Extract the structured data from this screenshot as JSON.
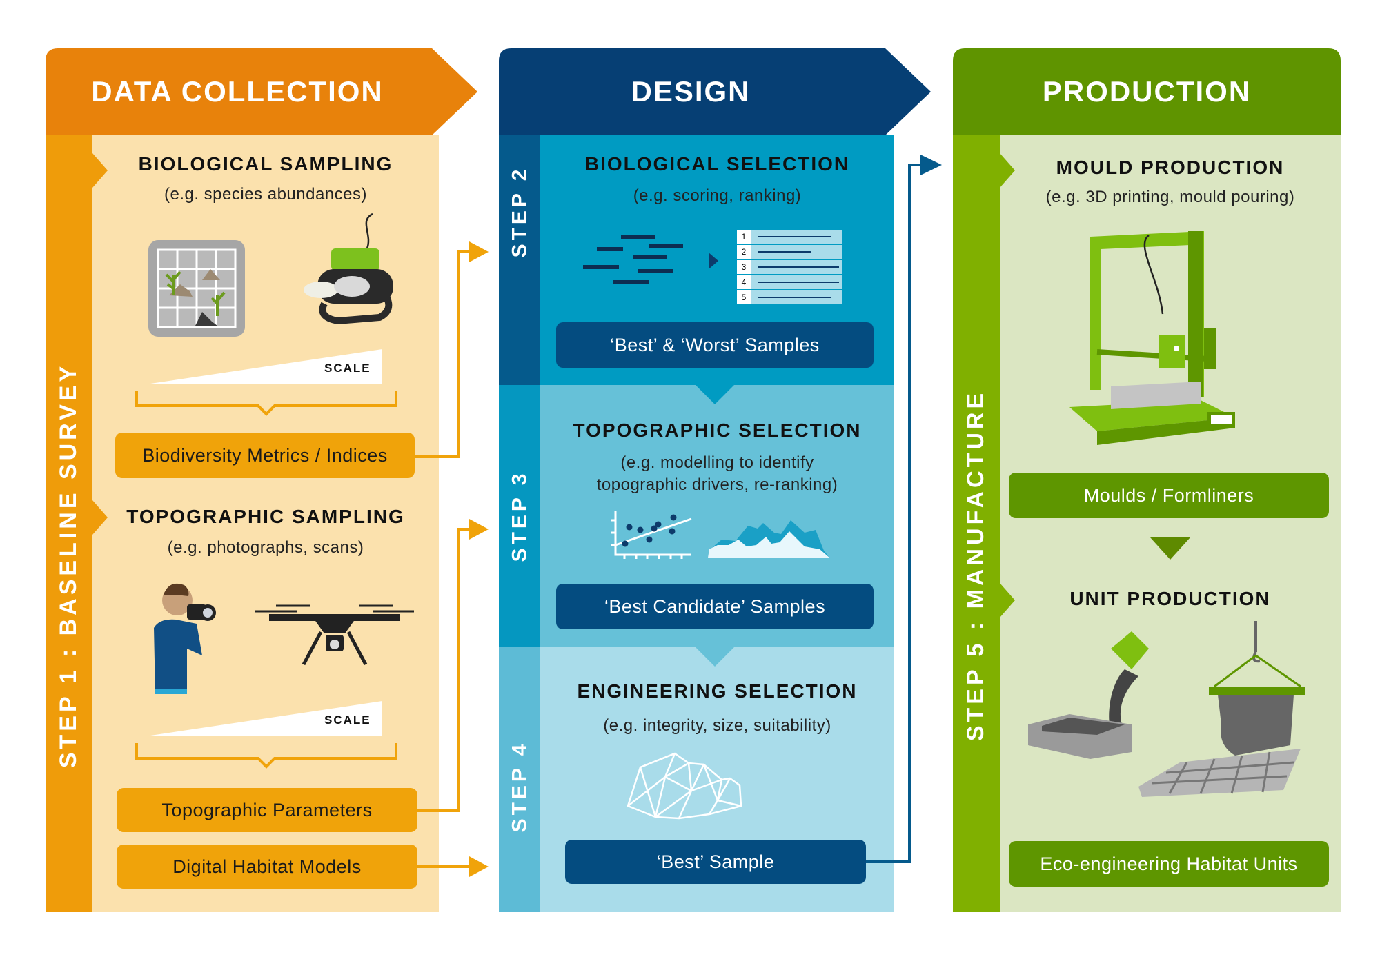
{
  "colors": {
    "orange_header": "#e8820b",
    "orange_rail": "#ef9c0a",
    "orange_panel": "#fbe1ad",
    "orange_box": "#f0a30a",
    "navy_header": "#063f74",
    "step2_rail": "#055a8c",
    "step2_panel": "#009bc2",
    "step3_rail": "#0597c0",
    "step3_panel": "#66c1d8",
    "step4_rail": "#5dbbd6",
    "step4_panel": "#a9dcea",
    "navy_box": "#044c80",
    "green_header": "#5f9400",
    "green_rail": "#80b000",
    "green_panel": "#dbe6c2",
    "green_box": "#5e9600"
  },
  "columns": {
    "data_collection": {
      "header": "DATA COLLECTION",
      "rail_label": "STEP 1 : BASELINE SURVEY",
      "biological": {
        "title": "BIOLOGICAL SAMPLING",
        "subtitle": "(e.g. species abundances)",
        "scale_label": "SCALE",
        "icons": [
          "quadrat-grid-icon",
          "rov-drone-icon"
        ],
        "output": "Biodiversity Metrics / Indices"
      },
      "topographic": {
        "title": "TOPOGRAPHIC SAMPLING",
        "subtitle": "(e.g. photographs, scans)",
        "scale_label": "SCALE",
        "icons": [
          "photographer-icon",
          "aerial-drone-icon"
        ],
        "outputs": [
          "Topographic Parameters",
          "Digital Habitat Models"
        ]
      }
    },
    "design": {
      "header": "DESIGN",
      "steps": [
        {
          "rail_label": "STEP 2",
          "title": "BIOLOGICAL SELECTION",
          "subtitle": "(e.g. scoring, ranking)",
          "rank_numbers": [
            "1",
            "2",
            "3",
            "4",
            "5"
          ],
          "output": "‘Best’ & ‘Worst’ Samples"
        },
        {
          "rail_label": "STEP 3",
          "title": "TOPOGRAPHIC SELECTION",
          "subtitle_line1": "(e.g. modelling to identify",
          "subtitle_line2": "topographic drivers, re-ranking)",
          "output": "‘Best Candidate’ Samples"
        },
        {
          "rail_label": "STEP 4",
          "title": "ENGINEERING SELECTION",
          "subtitle": "(e.g. integrity, size, suitability)",
          "output": "‘Best’ Sample"
        }
      ]
    },
    "production": {
      "header": "PRODUCTION",
      "rail_label": "STEP 5 : MANUFACTURE",
      "mould": {
        "title": "MOULD PRODUCTION",
        "subtitle": "(e.g. 3D printing, mould pouring)",
        "output": "Moulds / Formliners"
      },
      "unit": {
        "title": "UNIT PRODUCTION",
        "output": "Eco-engineering Habitat Units"
      }
    }
  }
}
